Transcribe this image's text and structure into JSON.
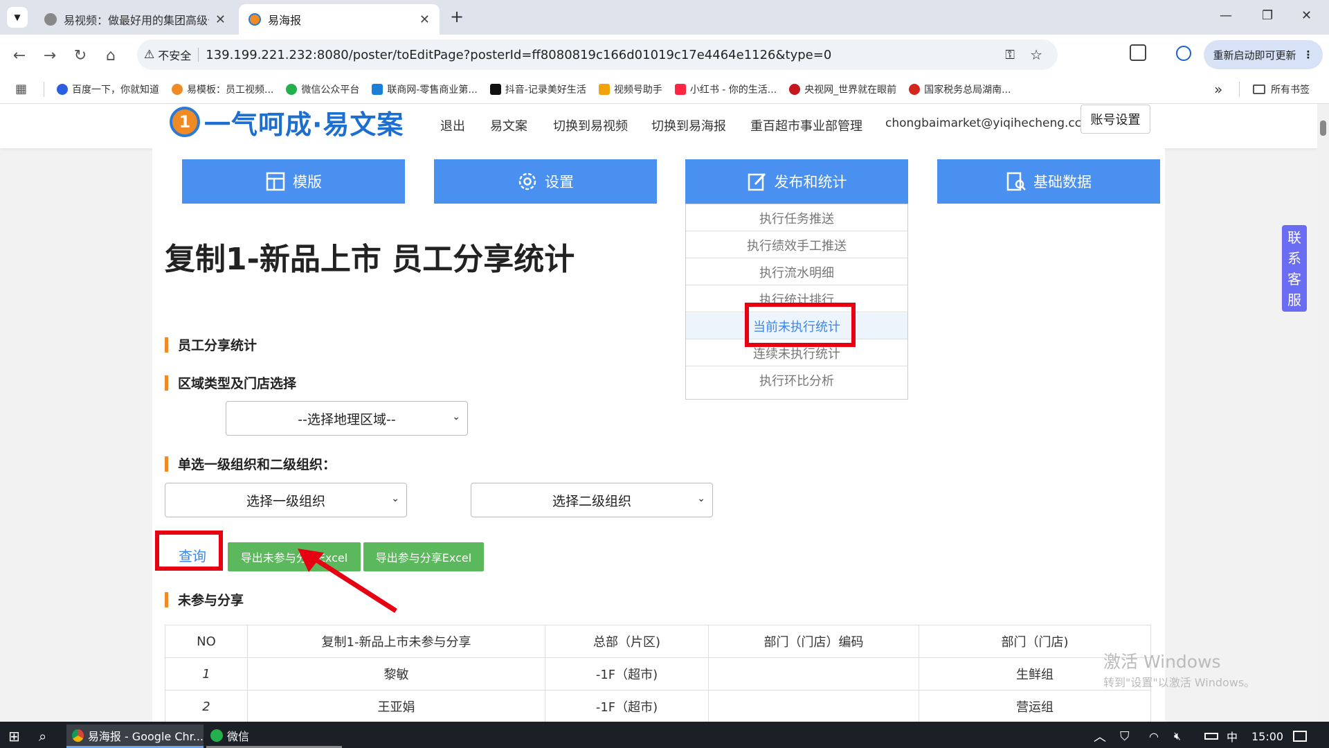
{
  "browser": {
    "tabs": [
      {
        "title": "易视频：做最好用的集团高级号",
        "active": false
      },
      {
        "title": "易海报",
        "active": true
      }
    ],
    "new_tab": "+",
    "window_controls": [
      "—",
      "❐",
      "✕"
    ],
    "address": {
      "security_label": "不安全",
      "url": "139.199.221.232:8080/poster/toEditPage?posterId=ff8080819c166d01019c17e4464e1126&type=0"
    },
    "update_button": "重新启动即可更新",
    "bookmarks": [
      {
        "label": "百度一下，你就知道",
        "color": "#2a5fe0"
      },
      {
        "label": "易模板：员工视频...",
        "color": "#f08a24"
      },
      {
        "label": "微信公众平台",
        "color": "#22b14c"
      },
      {
        "label": "联商网-零售商业第...",
        "color": "#1a7fd6"
      },
      {
        "label": "抖音-记录美好生活",
        "color": "#111111"
      },
      {
        "label": "视频号助手",
        "color": "#f2a20b"
      },
      {
        "label": "小红书 - 你的生活...",
        "color": "#ff2442"
      },
      {
        "label": "央视网_世界就在眼前",
        "color": "#c4161c"
      },
      {
        "label": "国家税务总局湖南...",
        "color": "#d4261c"
      }
    ],
    "bookmarks_more": "»",
    "all_bookmarks": "所有书签"
  },
  "site": {
    "logo_text": "一气呵成·易文案",
    "nav": [
      "退出",
      "易文案",
      "切换到易视频",
      "切换到易海报",
      "重百超市事业部管理",
      "chongbaimarket@yiqihecheng.cc"
    ],
    "account_button": "账号设置",
    "menu": [
      "模版",
      "设置",
      "发布和统计",
      "基础数据"
    ],
    "dropdown": [
      "执行任务推送",
      "执行绩效手工推送",
      "执行流水明细",
      "执行统计排行",
      "当前未执行统计",
      "连续未执行统计",
      "执行环比分析"
    ],
    "side_service": [
      "联",
      "系",
      "客",
      "服"
    ]
  },
  "main": {
    "page_title": "复制1-新品上市 员工分享统计",
    "section_stats": "员工分享统计",
    "section_region": "区域类型及门店选择",
    "region_select": "--选择地理区域--",
    "section_org": "单选一级组织和二级组织：",
    "org1_select": "选择一级组织",
    "org2_select": "选择二级组织",
    "query_button": "查询",
    "export_unshared": "导出未参与分享Excel",
    "export_shared": "导出参与分享Excel",
    "section_unshared": "未参与分享",
    "table": {
      "headers": [
        "NO",
        "复制1-新品上市未参与分享",
        "总部（片区)",
        "部门（门店）编码",
        "部门（门店)"
      ],
      "rows": [
        [
          "1",
          "黎敏",
          "-1F（超市)",
          "",
          "生鲜组"
        ],
        [
          "2",
          "王亚娟",
          "-1F（超市)",
          "",
          "营运组"
        ]
      ]
    }
  },
  "watermark": {
    "line1": "激活 Windows",
    "line2": "转到\"设置\"以激活 Windows。"
  },
  "taskbar": {
    "chrome_label": "易海报 - Google Chr...",
    "wechat_label": "微信",
    "ime": "中",
    "clock": "15:00"
  },
  "colors": {
    "menu_blue": "#4a90f0",
    "accent_orange": "#f08a24",
    "export_green": "#5cb85c",
    "highlight_red": "#e60012"
  }
}
